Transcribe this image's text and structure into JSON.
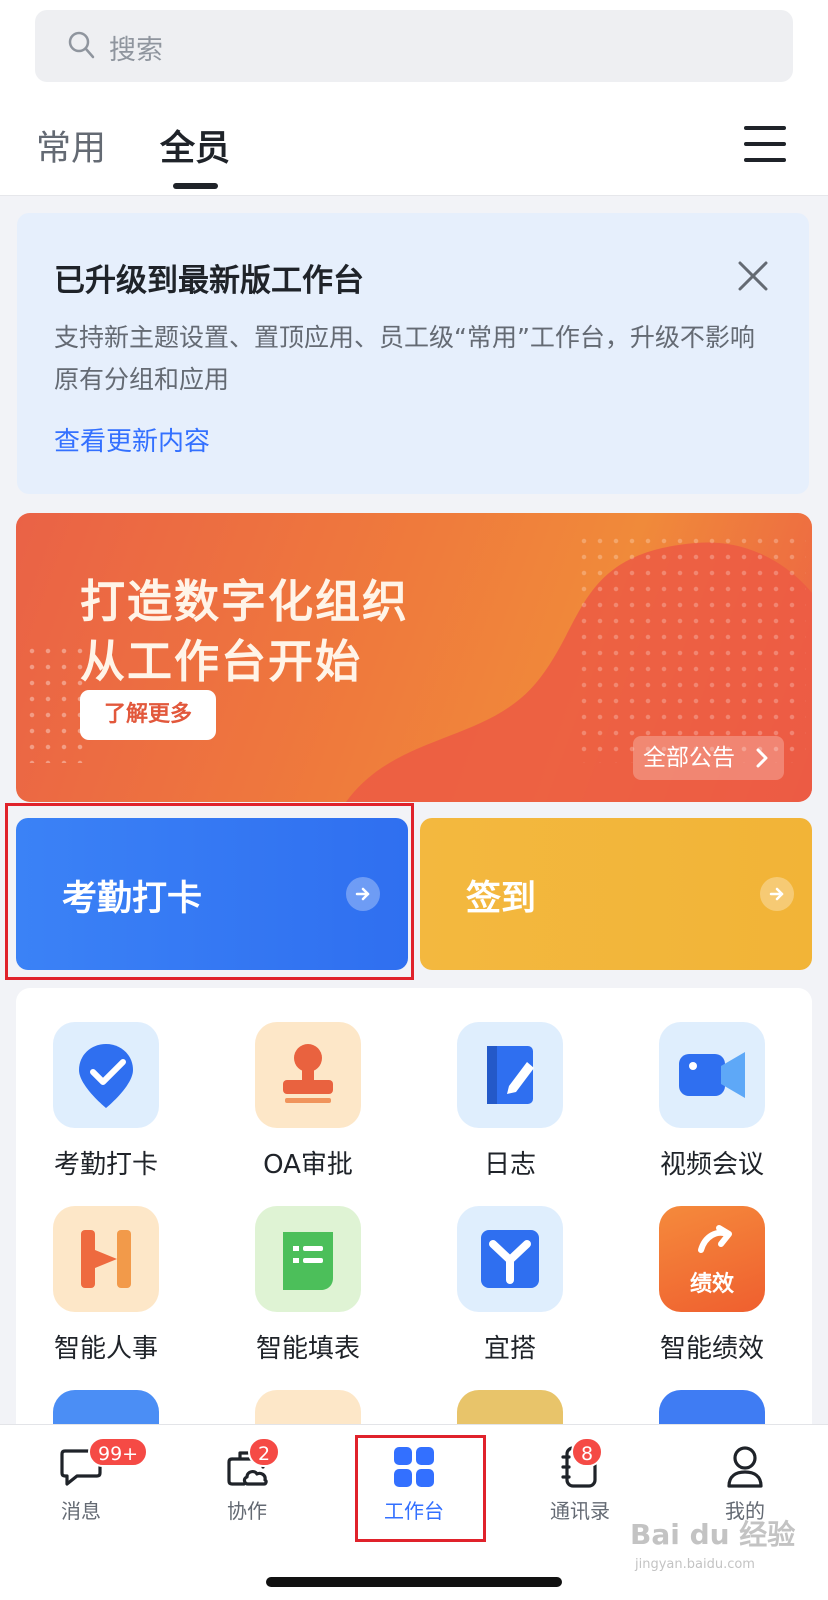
{
  "search": {
    "placeholder": "搜索"
  },
  "tabs": [
    {
      "label": "常用",
      "active": false
    },
    {
      "label": "全员",
      "active": true
    }
  ],
  "notice": {
    "title": "已升级到最新版工作台",
    "description": "支持新主题设置、置顶应用、员工级“常用”工作台，升级不影响原有分组和应用",
    "link": "查看更新内容"
  },
  "banner": {
    "line1": "打造数字化组织",
    "line2": "从工作台开始",
    "button": "了解更多",
    "all_announcements": "全部公告"
  },
  "quick_actions": [
    {
      "label": "考勤打卡",
      "color": "#3a7ef4"
    },
    {
      "label": "签到",
      "color": "#f3b83f"
    }
  ],
  "apps": [
    {
      "label": "考勤打卡",
      "icon": "location-check-icon"
    },
    {
      "label": "OA审批",
      "icon": "stamp-icon"
    },
    {
      "label": "日志",
      "icon": "notebook-edit-icon"
    },
    {
      "label": "视频会议",
      "icon": "video-camera-icon"
    },
    {
      "label": "智能人事",
      "icon": "h-letter-icon"
    },
    {
      "label": "智能填表",
      "icon": "form-sheet-icon"
    },
    {
      "label": "宜搭",
      "icon": "y-letter-icon"
    },
    {
      "label": "智能绩效",
      "icon": "performance-icon",
      "icon_text": "绩效"
    }
  ],
  "nav": [
    {
      "label": "消息",
      "icon": "chat-bubble-icon",
      "badge": "99+"
    },
    {
      "label": "协作",
      "icon": "briefcase-cloud-icon",
      "badge": "2"
    },
    {
      "label": "工作台",
      "icon": "grid-icon",
      "active": true
    },
    {
      "label": "通讯录",
      "icon": "phone-book-icon",
      "badge": "8"
    },
    {
      "label": "我的",
      "icon": "user-icon"
    }
  ],
  "watermark": {
    "text": "Bai du 经验",
    "sub": "jingyan.baidu.com"
  },
  "colors": {
    "accent": "#3370ff",
    "badge": "#f54a45",
    "highlight": "#e0222b"
  }
}
